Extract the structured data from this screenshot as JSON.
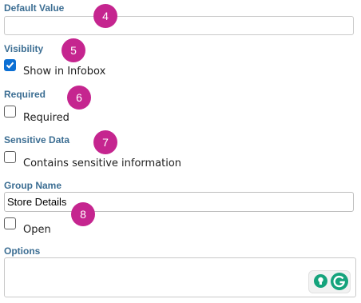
{
  "fields": {
    "default_value": {
      "label": "Default Value",
      "value": ""
    },
    "visibility": {
      "label": "Visibility",
      "checkbox_label": "Show in Infobox",
      "checked": true
    },
    "required": {
      "label": "Required",
      "checkbox_label": "Required",
      "checked": false
    },
    "sensitive": {
      "label": "Sensitive Data",
      "checkbox_label": "Contains sensitive information",
      "checked": false
    },
    "group_name": {
      "label": "Group Name",
      "value": "Store Details"
    },
    "open": {
      "checkbox_label": "Open",
      "checked": false
    },
    "options": {
      "label": "Options",
      "value": ""
    }
  },
  "badges": [
    "4",
    "5",
    "6",
    "7",
    "8"
  ],
  "colors": {
    "label": "#3c6e93",
    "badge": "#c5258f",
    "checkbox_checked": "#0b6fd4",
    "grammarly": "#15a37c"
  },
  "icons": [
    "lightbulb-icon",
    "grammarly-icon"
  ]
}
